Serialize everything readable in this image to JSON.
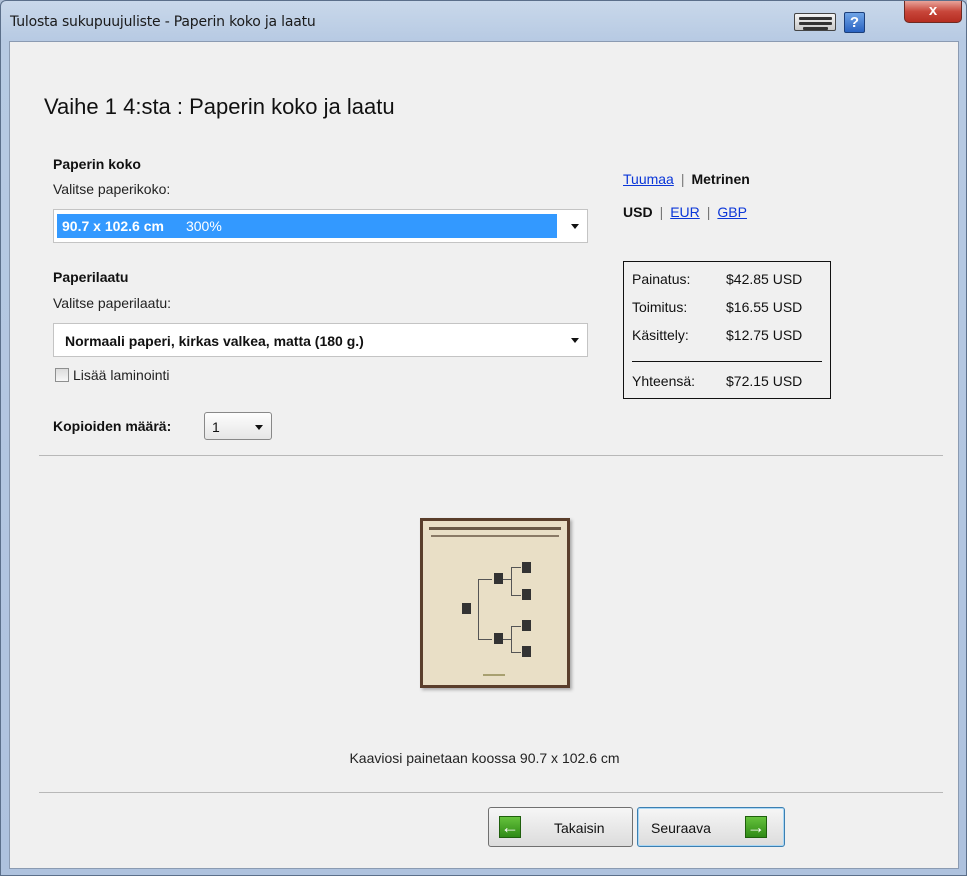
{
  "window": {
    "title": "Tulosta sukupuujuliste - Paperin koko ja laatu",
    "help_label": "?",
    "close_label": "x"
  },
  "step": {
    "title": "Vaihe 1 4:sta : Paperin koko ja laatu"
  },
  "paper_size": {
    "heading": "Paperin koko",
    "prompt": "Valitse paperikoko:",
    "selected_size": "90.7 x 102.6 cm",
    "selected_scale": "300%"
  },
  "paper_quality": {
    "heading": "Paperilaatu",
    "prompt": "Valitse paperilaatu:",
    "selected": "Normaali paperi, kirkas valkea, matta (180 g.)",
    "laminate_label": "Lisää laminointi",
    "laminate_checked": false
  },
  "copies": {
    "label": "Kopioiden määrä:",
    "value": "1"
  },
  "units": {
    "inch": "Tuumaa",
    "metric": "Metrinen"
  },
  "currency": {
    "usd": "USD",
    "eur": "EUR",
    "gbp": "GBP"
  },
  "prices": {
    "rows": [
      {
        "label": "Painatus:",
        "value": "$42.85 USD"
      },
      {
        "label": "Toimitus:",
        "value": "$16.55 USD"
      },
      {
        "label": "Käsittely:",
        "value": "$12.75 USD"
      }
    ],
    "total_label": "Yhteensä:",
    "total_value": "$72.15 USD"
  },
  "preview_caption": "Kaaviosi painetaan koossa 90.7 x 102.6 cm",
  "buttons": {
    "back": "Takaisin",
    "next": "Seuraava"
  },
  "icons": {
    "keyboard": "keyboard-icon",
    "help": "help-icon",
    "close": "close-icon",
    "back_arrow": "arrow-left-icon",
    "next_arrow": "arrow-right-icon"
  },
  "colors": {
    "selection": "#3399ff",
    "link": "#0a36d8",
    "arrow_green": "#3a9a1e"
  }
}
